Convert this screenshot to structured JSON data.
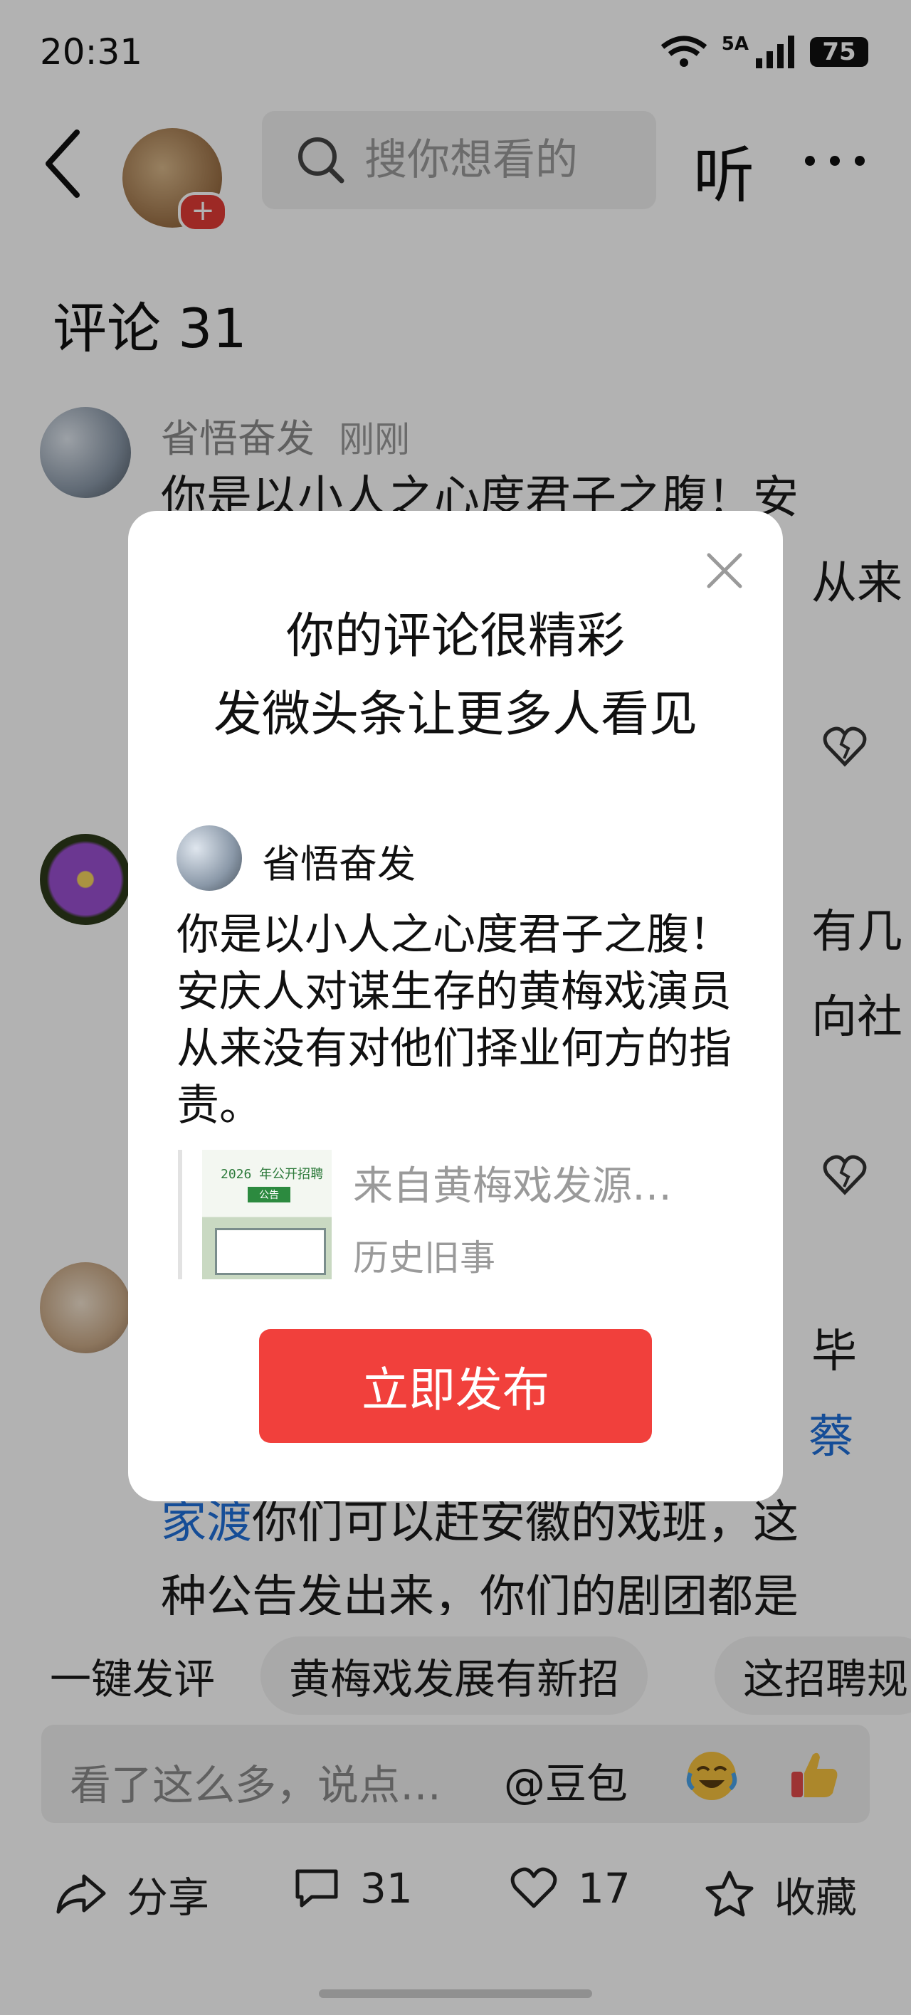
{
  "status": {
    "time": "20:31",
    "network": "5A",
    "battery": "75"
  },
  "nav": {
    "search_placeholder": "搜你想看的",
    "listen": "听"
  },
  "comments": {
    "title": "评论 31",
    "c1": {
      "name": "省悟奋发",
      "time": "刚刚",
      "line1": "你是以小人之心度君子之腹！安",
      "line2_tail": "从来"
    },
    "c2": {
      "line1_tail": "有几",
      "line2_tail": "向社"
    },
    "c3": {
      "line1_tail": "毕",
      "line2_tail": "蔡",
      "line3_link": "家渡",
      "line3_rest": "你们可以赶安徽的戏班，这",
      "line4": "种公告发出来，你们的剧团都是"
    }
  },
  "chips": [
    "一键发评",
    "黄梅戏发展有新招",
    "这招聘规"
  ],
  "comment_bar": {
    "placeholder": "看了这么多，说点…",
    "mention": "@豆包"
  },
  "actions": {
    "share": "分享",
    "comments": "31",
    "likes": "17",
    "favorite": "收藏"
  },
  "modal": {
    "title_line1": "你的评论很精彩",
    "title_line2": "发微头条让更多人看见",
    "author": "省悟奋发",
    "text": "你是以小人之心度君子之腹！安庆人对谋生存的黄梅戏演员从来没有对他们择业何方的指责。",
    "source": "来自黄梅戏发源…",
    "category": "历史旧事",
    "thumb_text": "2026 年公开招聘",
    "thumb_badge": "公告",
    "publish": "立即发布"
  }
}
